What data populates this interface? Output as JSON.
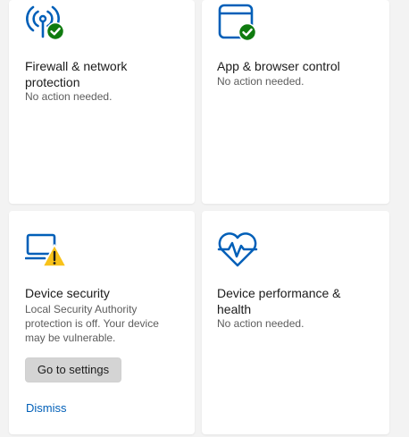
{
  "colors": {
    "accent": "#005fb8",
    "ok_green": "#0f7b0f",
    "warning_yellow": "#f8c21a",
    "page_bg": "#f3f3f3",
    "card_bg": "#ffffff",
    "muted_text": "#5d5d5d"
  },
  "cards": [
    {
      "icon": "wifi-antenna-check-icon",
      "title": "Firewall & network protection",
      "status": "No action needed."
    },
    {
      "icon": "browser-window-check-icon",
      "title": "App & browser control",
      "status": "No action needed."
    },
    {
      "icon": "laptop-warning-icon",
      "title": "Device security",
      "status": "Local Security Authority protection is off. Your device may be vulnerable.",
      "button_label": "Go to settings",
      "link_label": "Dismiss"
    },
    {
      "icon": "heart-pulse-icon",
      "title": "Device performance & health",
      "status": "No action needed."
    }
  ]
}
